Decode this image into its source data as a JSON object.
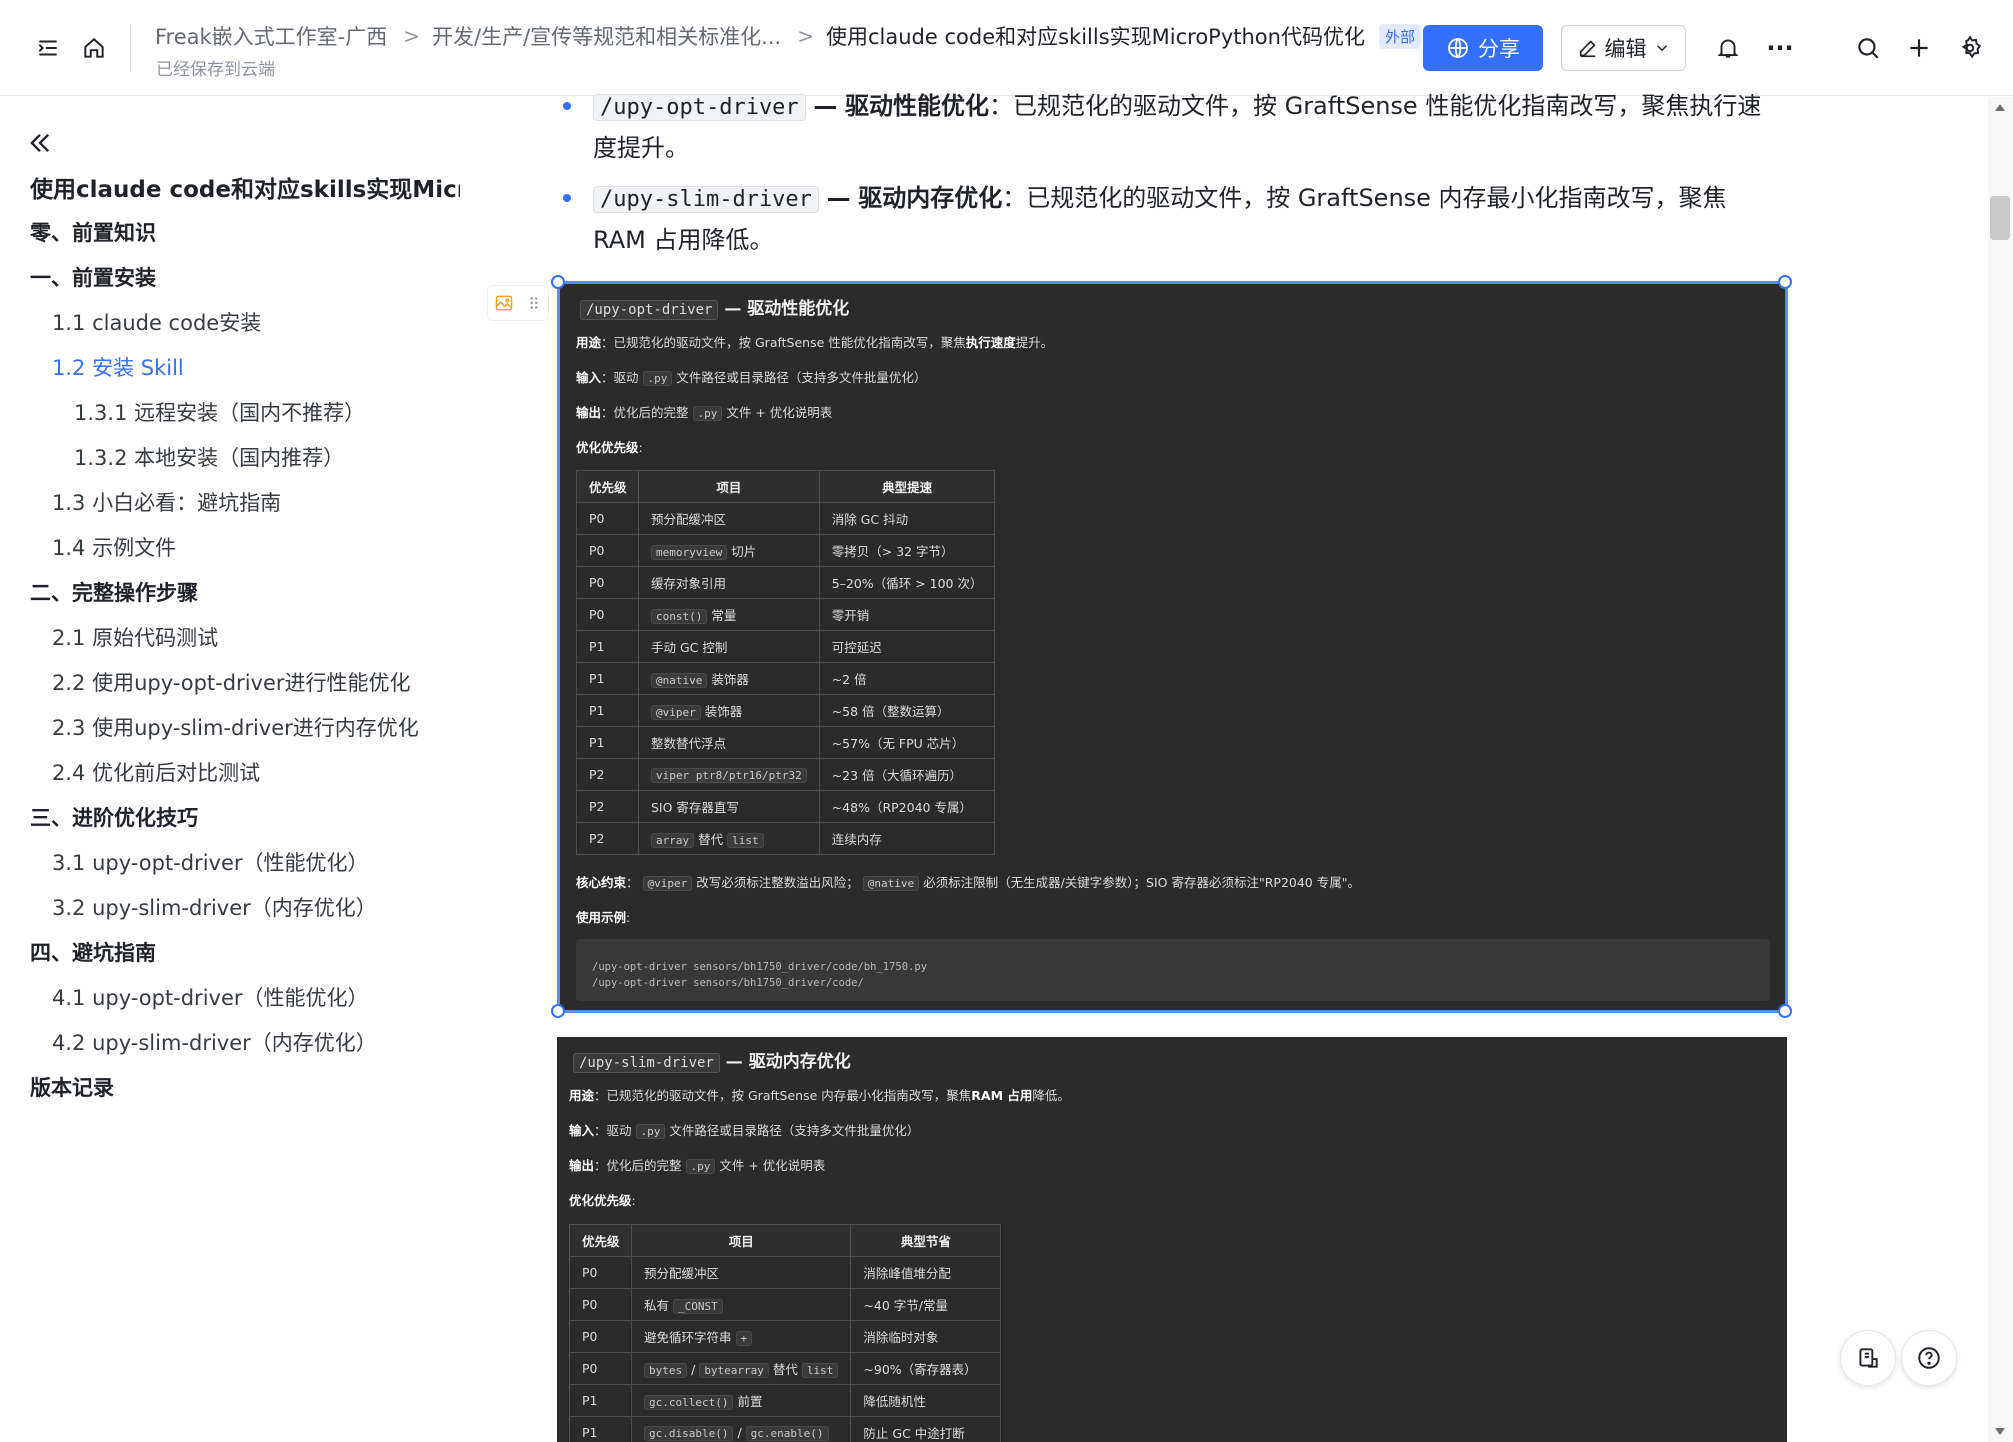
{
  "header": {
    "breadcrumbs": [
      "Freak嵌入式工作室-广西",
      "开发/生产/宣传等规范和相关标准化...",
      "使用claude code和对应skills实现MicroPython代码优化"
    ],
    "breadcrumb_sep": ">",
    "external_badge": "外部",
    "saved_status": "已经保存到云端",
    "share_label": "分享",
    "edit_label": "编辑",
    "more_glyph": "···"
  },
  "sidebar": {
    "title": "使用claude code和对应skills实现Micr...",
    "items": [
      {
        "label": "零、前置知识",
        "level": 1
      },
      {
        "label": "一、前置安装",
        "level": 1
      },
      {
        "label": "1.1 claude code安装",
        "level": 2
      },
      {
        "label": "1.2 安装 Skill",
        "level": 2,
        "active": true
      },
      {
        "label": "1.3.1 远程安装（国内不推荐）",
        "level": 3
      },
      {
        "label": "1.3.2 本地安装（国内推荐）",
        "level": 3
      },
      {
        "label": "1.3 小白必看：避坑指南",
        "level": 2
      },
      {
        "label": "1.4 示例文件",
        "level": 2
      },
      {
        "label": "二、完整操作步骤",
        "level": 1
      },
      {
        "label": "2.1 原始代码测试",
        "level": 2
      },
      {
        "label": "2.2 使用upy-opt-driver进行性能优化",
        "level": 2
      },
      {
        "label": "2.3 使用upy-slim-driver进行内存优化",
        "level": 2
      },
      {
        "label": "2.4 优化前后对比测试",
        "level": 2
      },
      {
        "label": "三、进阶优化技巧",
        "level": 1
      },
      {
        "label": "3.1 upy-opt-driver（性能优化）",
        "level": 2
      },
      {
        "label": "3.2 upy-slim-driver（内存优化）",
        "level": 2
      },
      {
        "label": "四、避坑指南",
        "level": 1
      },
      {
        "label": "4.1 upy-opt-driver（性能优化）",
        "level": 2
      },
      {
        "label": "4.2 upy-slim-driver（内存优化）",
        "level": 2
      },
      {
        "label": "版本记录",
        "level": 1
      }
    ]
  },
  "content": {
    "bullet1": {
      "code": "/upy-opt-driver",
      "dash": "—",
      "bold": "驱动性能优化",
      "text_l1": "：已规范化的驱动文件，按 GraftSense 性能优化指南改写，聚焦执行速",
      "text_l2": "度提升。"
    },
    "bullet2": {
      "code": "/upy-slim-driver",
      "dash": "—",
      "bold": "驱动内存优化",
      "text_l1": "：已规范化的驱动文件，按 GraftSense 内存最小化指南改写，聚焦",
      "text_l2": "RAM 占用降低。"
    },
    "image1": {
      "title_code": "/upy-opt-driver",
      "title_text": "— 驱动性能优化",
      "purpose_label": "用途",
      "purpose_text": "：已规范化的驱动文件，按 GraftSense 性能优化指南改写，聚焦",
      "purpose_bold": "执行速度",
      "purpose_tail": "提升。",
      "input_label": "输入",
      "input_text1": "：驱动",
      "input_code": ".py",
      "input_text2": "文件路径或目录路径（支持多文件批量优化）",
      "output_label": "输出",
      "output_text1": "：优化后的完整",
      "output_code": ".py",
      "output_text2": "文件 + 优化说明表",
      "priority_label": "优化优先级",
      "table_headers": [
        "优先级",
        "项目",
        "典型提速"
      ],
      "rows": [
        [
          "P0",
          "预分配缓冲区",
          "消除 GC 抖动"
        ],
        [
          "P0",
          "memoryview|切片",
          "零拷贝（> 32 字节）"
        ],
        [
          "P0",
          "缓存对象引用",
          "5–20%（循环 > 100 次）"
        ],
        [
          "P0",
          "const()|常量",
          "零开销"
        ],
        [
          "P1",
          "手动 GC 控制",
          "可控延迟"
        ],
        [
          "P1",
          "@native|装饰器",
          "~2 倍"
        ],
        [
          "P1",
          "@viper|装饰器",
          "~58 倍（整数运算）"
        ],
        [
          "P1",
          "整数替代浮点",
          "~57%（无 FPU 芯片）"
        ],
        [
          "P2",
          "viper ptr8/ptr16/ptr32|",
          "~23 倍（大循环遍历）"
        ],
        [
          "P2",
          "SIO 寄存器直写",
          "~48%（RP2040 专属）"
        ],
        [
          "P2",
          "array|替代|list",
          "连续内存"
        ]
      ],
      "constraint_label": "核心约束",
      "constraint_code1": "@viper",
      "constraint_text1": "改写必须标注整数溢出风险；",
      "constraint_code2": "@native",
      "constraint_text2": "必须标注限制（无生成器/关键字参数）；SIO 寄存器必须标注\"RP2040 专属\"。",
      "example_label": "使用示例",
      "example_lines": [
        "/upy-opt-driver sensors/bh1750_driver/code/bh_1750.py",
        "/upy-opt-driver sensors/bh1750_driver/code/"
      ]
    },
    "image2": {
      "title_code": "/upy-slim-driver",
      "title_text": "— 驱动内存优化",
      "purpose_label": "用途",
      "purpose_text": "：已规范化的驱动文件，按 GraftSense 内存最小化指南改写，聚焦",
      "purpose_bold": "RAM 占用",
      "purpose_tail": "降低。",
      "input_label": "输入",
      "input_text1": "：驱动",
      "input_code": ".py",
      "input_text2": "文件路径或目录路径（支持多文件批量优化）",
      "output_label": "输出",
      "output_text1": "：优化后的完整",
      "output_code": ".py",
      "output_text2": "文件 + 优化说明表",
      "priority_label": "优化优先级",
      "table_headers": [
        "优先级",
        "项目",
        "典型节省"
      ],
      "rows": [
        [
          "P0",
          "预分配缓冲区",
          "消除峰值堆分配"
        ],
        [
          "P0",
          "私有|_CONST",
          "~40 字节/常量"
        ],
        [
          "P0",
          "避免循环字符串|+",
          "消除临时对象"
        ],
        [
          "P0",
          "bytes|/|bytearray|替代|list",
          "~90%（寄存器表）"
        ],
        [
          "P1",
          "gc.collect()|前置",
          "降低随机性"
        ],
        [
          "P1",
          "gc.disable()|/|gc.enable()",
          "防止 GC 中途打断"
        ]
      ]
    }
  },
  "colors": {
    "accent": "#3370ff",
    "image_bg": "#2b2b2b",
    "text": "#1f2329"
  },
  "icons": [
    "outline-toggle-icon",
    "home-icon",
    "pin-icon",
    "globe-icon",
    "pencil-icon",
    "chevron-down-icon",
    "bell-icon",
    "more-icon",
    "search-icon",
    "plus-icon",
    "gear-icon",
    "double-chevron-left-icon",
    "image-icon",
    "drag-handle-icon",
    "copy-doc-icon",
    "help-icon"
  ]
}
